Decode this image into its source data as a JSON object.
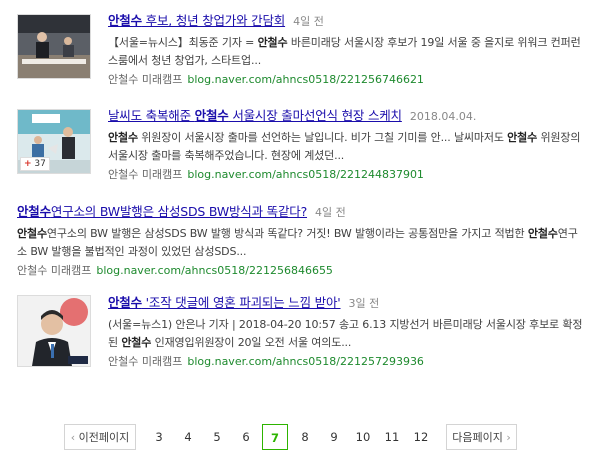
{
  "results": [
    {
      "title_kw": "안철수",
      "title_rest": " 후보, 청년 창업가와 간담회",
      "date": "4일 전",
      "desc_parts": [
        {
          "t": "【서울=뉴시스】최동준 기자 = ",
          "b": false
        },
        {
          "t": "안철수",
          "b": true
        },
        {
          "t": " 바른미래당 서울시장 후보가 19일 서울 중 을지로 위워크 컨퍼런스룸에서 청년 창업가, 스타트업...",
          "b": false
        }
      ],
      "blog_name": "안철수 미래캠프",
      "url": "blog.naver.com/ahncs0518/221256746621"
    },
    {
      "title_pre": "날씨도 축복해준 ",
      "title_kw": "안철수",
      "title_rest": " 서울시장 출마선언식 현장 스케치",
      "date": "2018.04.04.",
      "badge": "37",
      "desc_parts": [
        {
          "t": "안철수",
          "b": true
        },
        {
          "t": " 위원장이 서울시장 출마를 선언하는 날입니다. 비가 그칠 기미를 안... 날씨마저도 ",
          "b": false
        },
        {
          "t": "안철수",
          "b": true
        },
        {
          "t": " 위원장의 서울시장 출마를 축복해주었습니다. 현장에 계셨던...",
          "b": false
        }
      ],
      "blog_name": "안철수 미래캠프",
      "url": "blog.naver.com/ahncs0518/221244837901"
    },
    {
      "title_kw": "안철수",
      "title_rest": "연구소의 BW발행은 삼성SDS BW방식과 똑같다?",
      "date": "4일 전",
      "desc_parts": [
        {
          "t": "안철수",
          "b": true
        },
        {
          "t": "연구소의 BW 발행은 삼성SDS BW 발행 방식과 똑같다? 거짓! BW 발행이라는 공통점만을 가지고 적법한 ",
          "b": false
        },
        {
          "t": "안철수",
          "b": true
        },
        {
          "t": "연구소 BW 발행을 불법적인 과정이 있었던 삼성SDS...",
          "b": false
        }
      ],
      "blog_name": "안철수 미래캠프",
      "url": "blog.naver.com/ahncs0518/221256846655"
    },
    {
      "title_kw": "안철수",
      "title_rest": " '조작 댓글에 영혼 파괴되는 느낌 받아'",
      "date": "3일 전",
      "desc_parts": [
        {
          "t": "(서울=뉴스1) 안은나 기자 | 2018-04-20 10:57 송고 6.13 지방선거 바른미래당 서울시장 후보로 확정된 ",
          "b": false
        },
        {
          "t": "안철수",
          "b": true
        },
        {
          "t": " 인재영입위원장이 20일 오전 서울 여의도...",
          "b": false
        }
      ],
      "blog_name": "안철수 미래캠프",
      "url": "blog.naver.com/ahncs0518/221257293936"
    }
  ],
  "pagination": {
    "prev_label": "이전페이지",
    "next_label": "다음페이지",
    "pages": [
      "3",
      "4",
      "5",
      "6",
      "7",
      "8",
      "9",
      "10",
      "11",
      "12"
    ],
    "current": "7"
  },
  "colors": {
    "title_link": "#1a0dab",
    "url": "#1e8a2e",
    "current_page": "#2db400"
  }
}
